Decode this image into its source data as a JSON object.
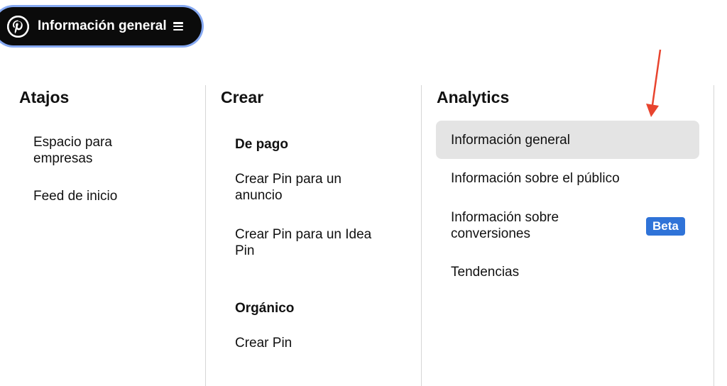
{
  "header": {
    "title": "Información general",
    "logo_icon": "pinterest-logo",
    "menu_icon": "hamburger-icon"
  },
  "columns": {
    "shortcuts": {
      "title": "Atajos",
      "items": [
        {
          "line1": "Espacio para",
          "line2": "empresas"
        },
        {
          "line1": "Feed de inicio",
          "line2": ""
        }
      ]
    },
    "create": {
      "title": "Crear",
      "paid_heading": "De pago",
      "paid_items": [
        {
          "line1": "Crear Pin para un",
          "line2": "anuncio"
        },
        {
          "line1": "Crear Pin para un Idea",
          "line2": "Pin"
        }
      ],
      "organic_heading": "Orgánico",
      "organic_items": [
        {
          "line1": "Crear Pin"
        }
      ]
    },
    "analytics": {
      "title": "Analytics",
      "items": [
        {
          "line1": "Información general",
          "selected": true
        },
        {
          "line1": "Información sobre el público"
        },
        {
          "line1": "Información sobre",
          "line2": "conversiones",
          "badge": "Beta"
        },
        {
          "line1": "Tendencias"
        }
      ]
    }
  },
  "colors": {
    "pill_bg": "#0b0b0b",
    "pill_ring": "#86a9f2",
    "highlight": "#e4e4e4",
    "badge": "#2f73d8",
    "arrow": "#e8442e"
  }
}
